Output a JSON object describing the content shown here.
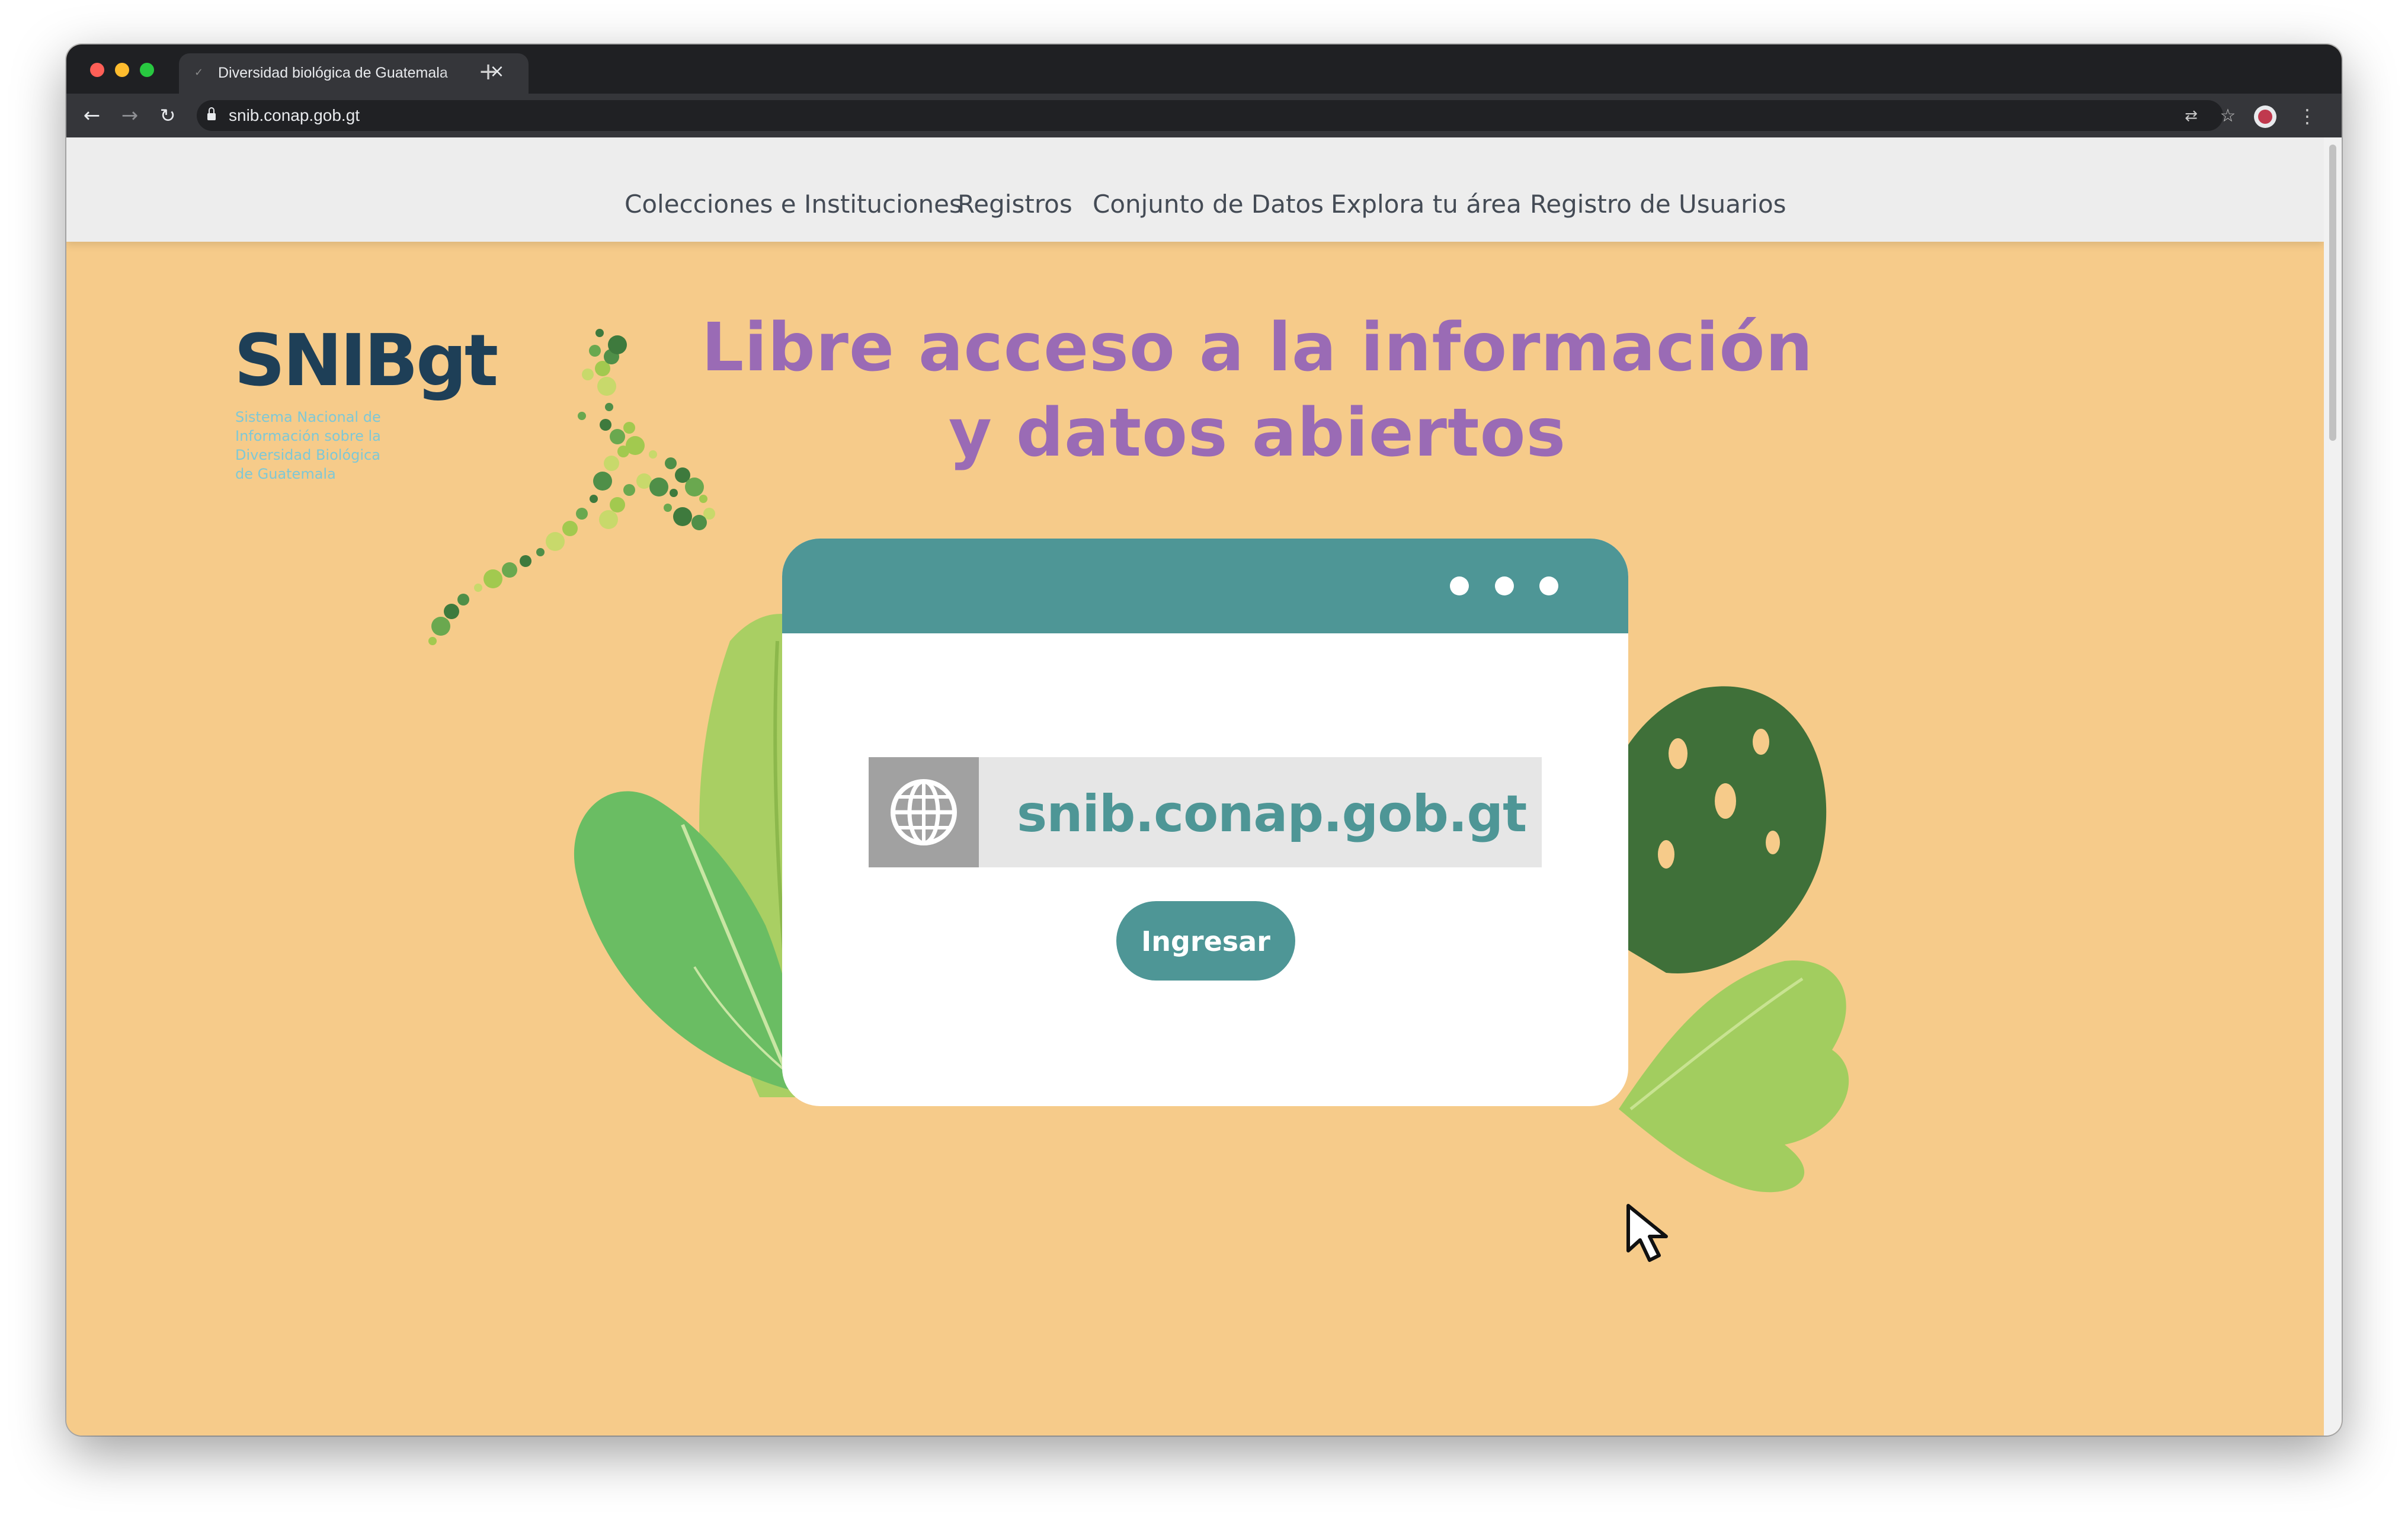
{
  "browser": {
    "tab_title": "Diversidad biológica de Guatemala",
    "tab_close": "×",
    "new_tab": "+",
    "url": "snib.conap.gob.gt"
  },
  "nav": {
    "items": [
      "Colecciones e Instituciones",
      "Registros",
      "Conjunto de Datos",
      "Explora tu área",
      "Registro de Usuarios"
    ]
  },
  "logo": {
    "name": "SNIBgt",
    "subtitle": [
      "Sistema Nacional de",
      "Información sobre la",
      "Diversidad Biológica",
      "de Guatemala"
    ]
  },
  "hero": {
    "headline_line1": "Libre acceso a la información",
    "headline_line2": "y datos abiertos",
    "site_url": "snib.conap.gob.gt",
    "button_label": "Ingresar"
  },
  "icons": {
    "globe": "globe-icon",
    "lock": "lock-icon",
    "cursor": "arrow-cursor-icon"
  },
  "colors": {
    "page_background": "#f6cb8a",
    "headline": "#9a6bb5",
    "teal": "#4e9696",
    "logo_navy": "#1e3f57",
    "logo_subtitle": "#7ec8d6"
  }
}
